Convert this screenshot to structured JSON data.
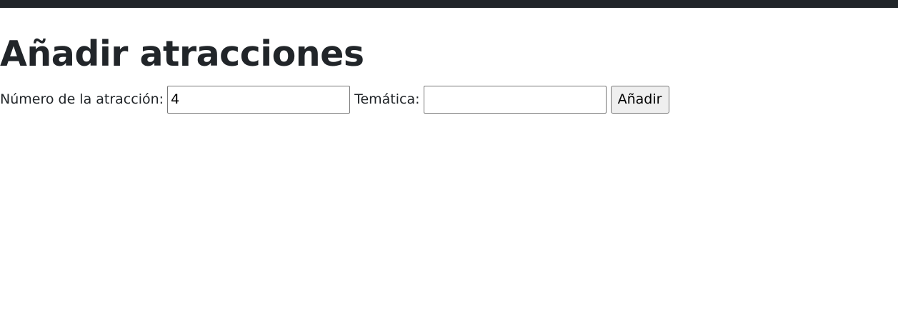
{
  "page": {
    "title": "Añadir atracciones"
  },
  "form": {
    "numero_label": "Número de la atracción:",
    "numero_value": "4",
    "tematica_label": "Temática:",
    "tematica_value": "",
    "submit_label": "Añadir"
  },
  "colors": {
    "topbar": "#212529",
    "text": "#212529",
    "button_bg": "#efefef"
  }
}
